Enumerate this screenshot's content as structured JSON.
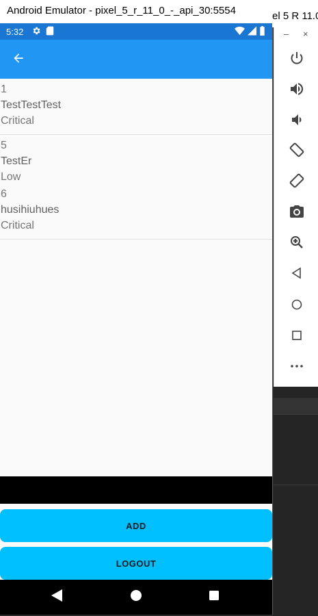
{
  "window": {
    "title": "Android Emulator - pixel_5_r_11_0_-_api_30:5554"
  },
  "side_panel": {
    "title_fragment": "el 5 R 11.0",
    "minimize": "–",
    "close": "×",
    "icons": [
      "power-icon",
      "volume-up-icon",
      "volume-down-icon",
      "rotate-left-icon",
      "rotate-right-icon",
      "camera-icon",
      "zoom-icon",
      "back-icon",
      "home-icon",
      "overview-icon",
      "more-icon"
    ]
  },
  "status_bar": {
    "time": "5:32"
  },
  "app_bar": {
    "back_icon": "arrow-back-icon",
    "color": "#2196f3",
    "status_color": "#1976d2"
  },
  "items": [
    {
      "id": "1",
      "title": "TestTestTest",
      "priority": "Critical"
    },
    {
      "id": "5",
      "title": "TestEr",
      "priority": "Low"
    },
    {
      "id": "6",
      "title": "husihiuhues",
      "priority": "Critical"
    }
  ],
  "buttons": {
    "add": "ADD",
    "logout": "LOGOUT",
    "color": "#00bfff"
  }
}
